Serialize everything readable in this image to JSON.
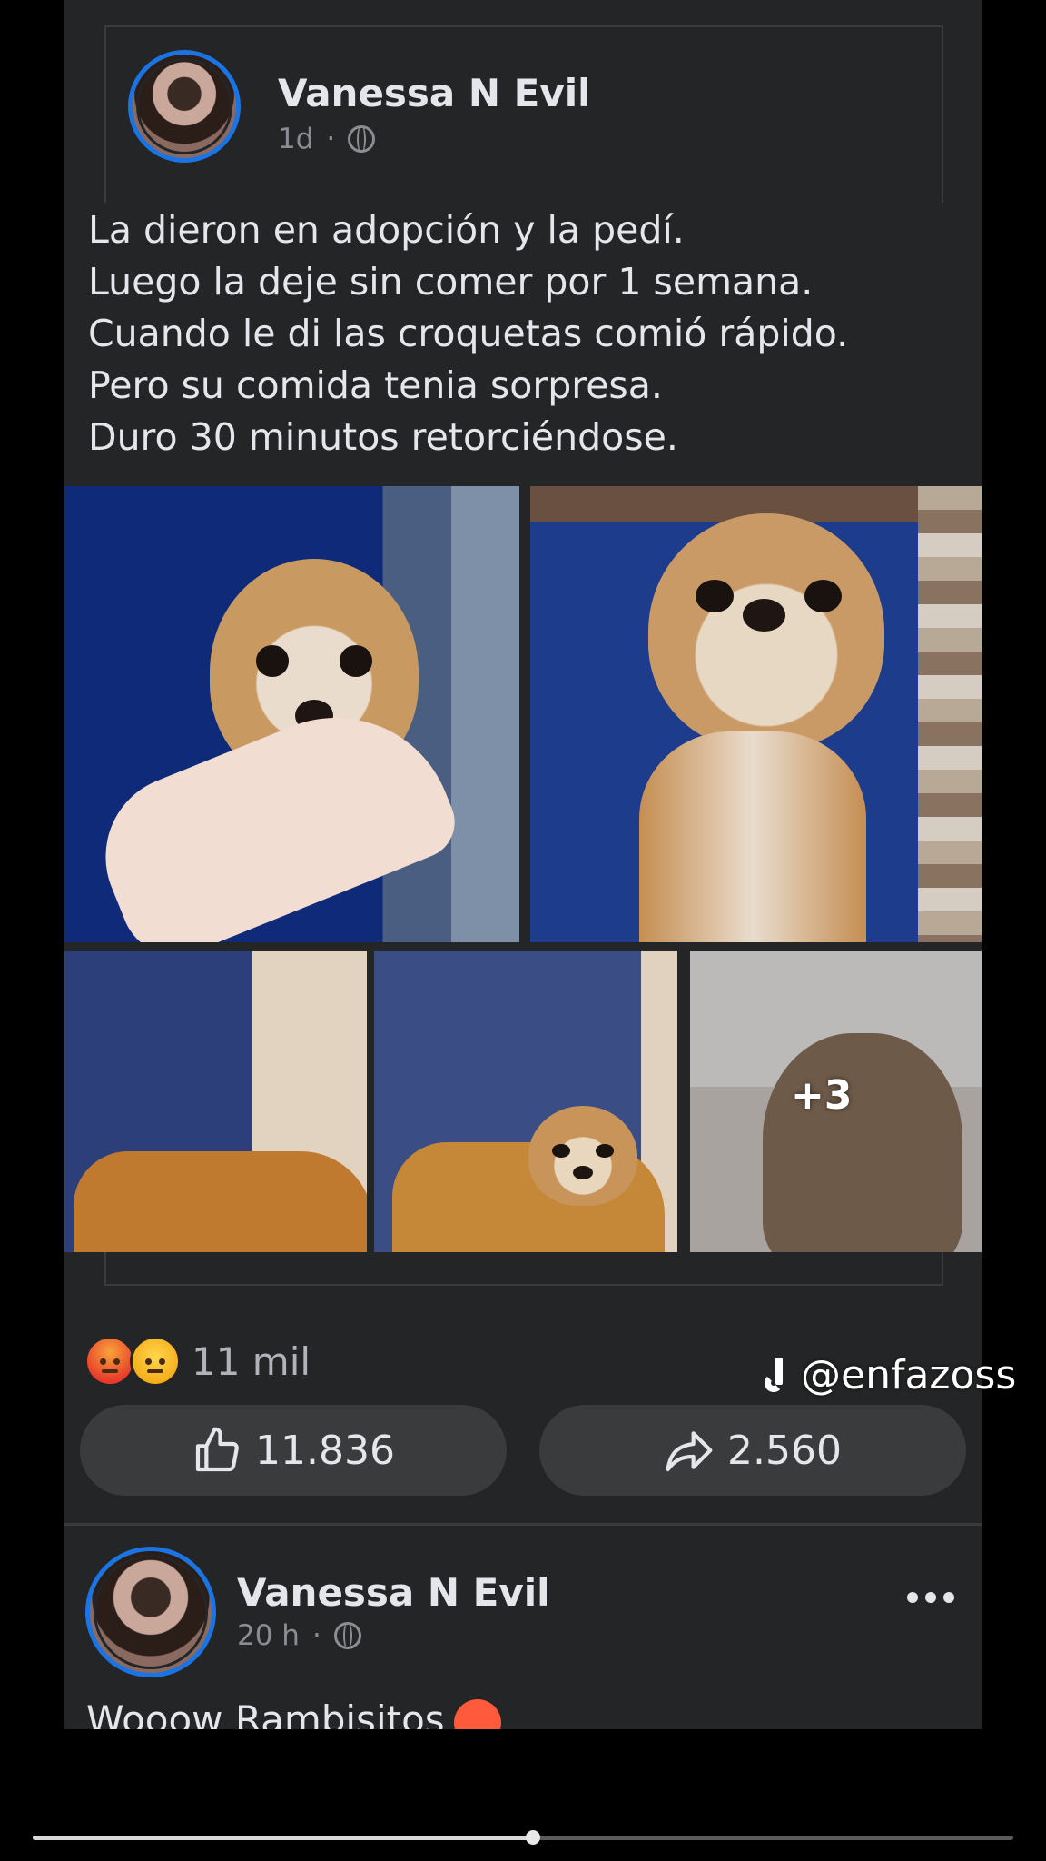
{
  "shared_post": {
    "author": "Vanessa N Evil",
    "time": "1d",
    "dot": "·",
    "caption_lines": [
      "La dieron en adopción y la pedí.",
      "Luego la deje sin comer por 1 semana.",
      "Cuando le di las croquetas comió rápido.",
      "Pero su comida tenia sorpresa.",
      "Duro 30 minutos retorciéndose."
    ],
    "more_photos": "+3"
  },
  "reactions": {
    "icons": [
      "angry-emoji",
      "sad-emoji"
    ],
    "count": "11 mil"
  },
  "actions": {
    "like_count": "11.836",
    "share_count": "2.560"
  },
  "next_post": {
    "author": "Vanessa N Evil",
    "time": "20 h",
    "dot": "·",
    "text": "Wooow Rambisitos"
  },
  "overlay": {
    "tiktok_handle": "@enfazoss"
  },
  "video": {
    "progress": 0.51
  },
  "colors": {
    "background": "#242526",
    "accent": "#1b74e4",
    "text": "#e4e6eb",
    "muted": "#8a8d91"
  }
}
